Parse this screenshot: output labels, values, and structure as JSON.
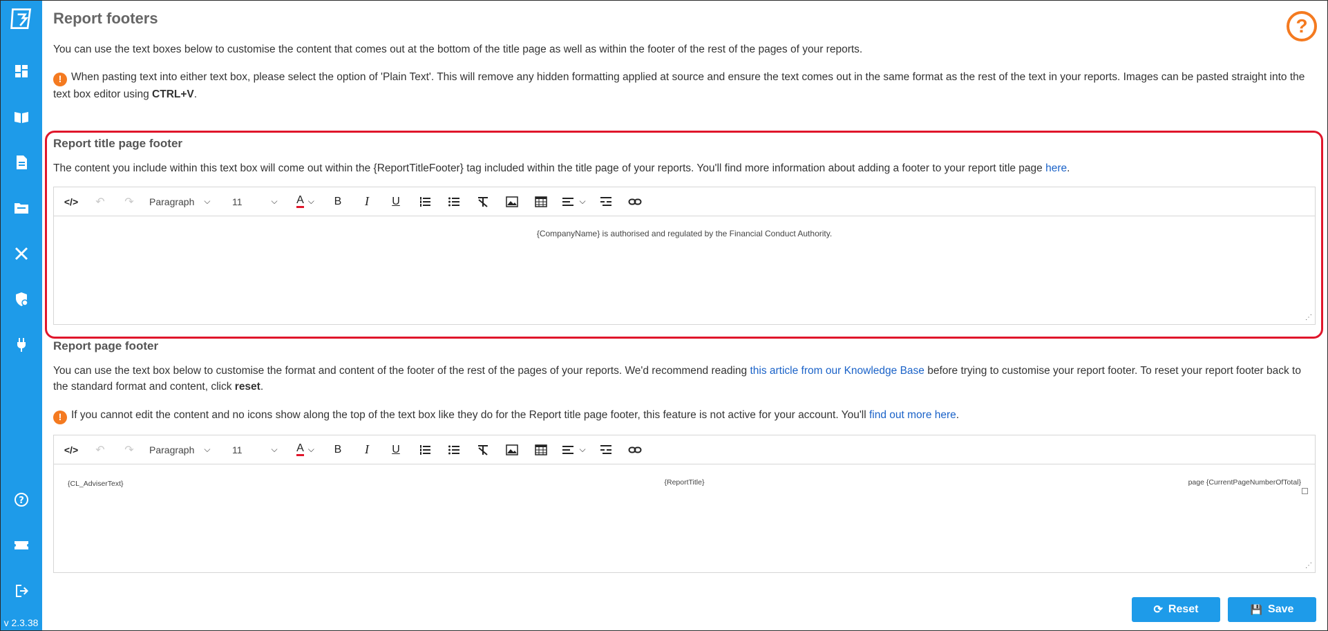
{
  "sidebar": {
    "logo_icon": "app-logo-icon",
    "top_items": [
      {
        "name": "dashboard-icon"
      },
      {
        "name": "knowledge-book-icon"
      },
      {
        "name": "document-icon"
      },
      {
        "name": "folder-icon"
      },
      {
        "name": "tools-icon"
      },
      {
        "name": "shield-settings-icon"
      },
      {
        "name": "plug-icon"
      }
    ],
    "bottom_items": [
      {
        "name": "help-circle-icon"
      },
      {
        "name": "ticket-icon"
      },
      {
        "name": "logout-icon"
      }
    ],
    "version": "v 2.3.38"
  },
  "header": {
    "title": "Report footers",
    "help_glyph": "?"
  },
  "intro": {
    "text": "You can use the text boxes below to customise the content that comes out at the bottom of the title page as well as within the footer of the rest of the pages of your reports.",
    "warning_glyph": "!",
    "paste_note_part1": "When pasting text into either text box, please select the option of 'Plain Text'. This will remove any hidden formatting applied at source and ensure the text comes out in the same format as the rest of the text in your reports. Images can be pasted straight into the text box editor using ",
    "paste_note_bold": "CTRL+V",
    "paste_note_end": "."
  },
  "title_footer": {
    "heading": "Report title page footer",
    "description_part1": "The content you include within this text box will come out within the {ReportTitleFooter} tag included within the title page of your reports. You'll find more information about adding a footer to your report title page ",
    "description_link": "here",
    "description_end": ".",
    "content_text": "{CompanyName} is authorised and regulated by the Financial Conduct Authority."
  },
  "page_footer": {
    "heading": "Report page footer",
    "description_part1": "You can use the text box below to customise the format and content of the footer of the rest of the pages of your reports. We'd recommend reading ",
    "description_link": "this article from our Knowledge Base",
    "description_part2": " before trying to customise your report footer. To reset your report footer back to the standard format and content, click ",
    "description_bold": "reset",
    "description_end": ".",
    "warning_part1": "If you cannot edit the content and no icons show along the top of the text box like they do for the Report title page footer, this feature is not active for your account. You'll ",
    "warning_link": "find out more here",
    "warning_end": ".",
    "content_left": "{CL_AdviserText}",
    "content_center": "{ReportTitle}",
    "content_right": "page {CurrentPageNumberOfTotal}"
  },
  "toolbar": {
    "source_glyph": "</>",
    "undo_glyph": "↶",
    "redo_glyph": "↷",
    "format_select": "Paragraph",
    "size_select": "11",
    "font_color_glyph": "A",
    "bold_glyph": "B",
    "italic_glyph": "I",
    "underline_glyph": "U",
    "chevron": "⌵"
  },
  "actions": {
    "reset_label": "Reset",
    "save_label": "Save",
    "reset_glyph": "⟳",
    "save_glyph": "💾"
  },
  "colors": {
    "brand": "#1e9be9",
    "accent_orange": "#f47a20",
    "highlight_red": "#e0162b",
    "link": "#1a62c8"
  }
}
